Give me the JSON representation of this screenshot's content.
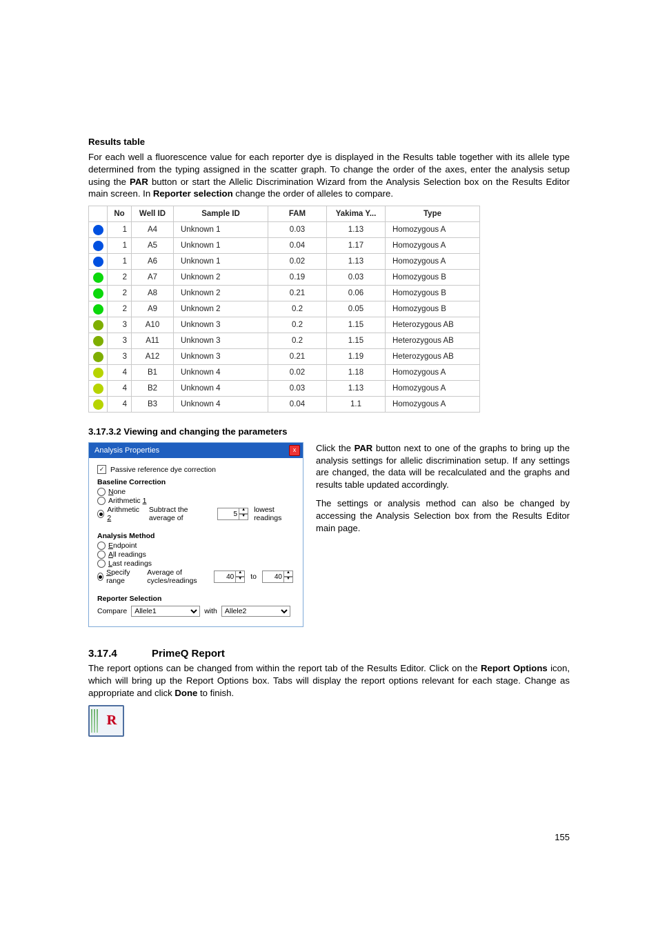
{
  "results_heading": "Results table",
  "results_para_a": "For each well a fluorescence value for each reporter dye is displayed in the Results table together with its allele type determined from the typing assigned in the scatter graph. To change the order of the axes, enter the analysis setup using the ",
  "results_para_b": "PAR",
  "results_para_c": " button or start the Allelic Discrimination Wizard from the Analysis Selection box on the Results Editor main screen. In ",
  "results_para_d": "Reporter selection",
  "results_para_e": " change the order of alleles to compare.",
  "tbl": {
    "headers": {
      "dot": "",
      "no": "No",
      "well": "Well ID",
      "sid": "Sample ID",
      "fam": "FAM",
      "yy": "Yakima Y...",
      "type": "Type"
    },
    "rows": [
      {
        "color": "blue",
        "no": "1",
        "well": "A4",
        "sid": "Unknown 1",
        "fam": "0.03",
        "yy": "1.13",
        "type": "Homozygous A"
      },
      {
        "color": "blue",
        "no": "1",
        "well": "A5",
        "sid": "Unknown 1",
        "fam": "0.04",
        "yy": "1.17",
        "type": "Homozygous A"
      },
      {
        "color": "blue",
        "no": "1",
        "well": "A6",
        "sid": "Unknown 1",
        "fam": "0.02",
        "yy": "1.13",
        "type": "Homozygous A"
      },
      {
        "color": "green",
        "no": "2",
        "well": "A7",
        "sid": "Unknown 2",
        "fam": "0.19",
        "yy": "0.03",
        "type": "Homozygous B"
      },
      {
        "color": "green",
        "no": "2",
        "well": "A8",
        "sid": "Unknown 2",
        "fam": "0.21",
        "yy": "0.06",
        "type": "Homozygous B"
      },
      {
        "color": "green",
        "no": "2",
        "well": "A9",
        "sid": "Unknown 2",
        "fam": "0.2",
        "yy": "0.05",
        "type": "Homozygous B"
      },
      {
        "color": "olive",
        "no": "3",
        "well": "A10",
        "sid": "Unknown 3",
        "fam": "0.2",
        "yy": "1.15",
        "type": "Heterozygous AB"
      },
      {
        "color": "olive",
        "no": "3",
        "well": "A11",
        "sid": "Unknown 3",
        "fam": "0.2",
        "yy": "1.15",
        "type": "Heterozygous AB"
      },
      {
        "color": "olive",
        "no": "3",
        "well": "A12",
        "sid": "Unknown 3",
        "fam": "0.21",
        "yy": "1.19",
        "type": "Heterozygous AB"
      },
      {
        "color": "ygreen",
        "no": "4",
        "well": "B1",
        "sid": "Unknown 4",
        "fam": "0.02",
        "yy": "1.18",
        "type": "Homozygous A"
      },
      {
        "color": "ygreen",
        "no": "4",
        "well": "B2",
        "sid": "Unknown 4",
        "fam": "0.03",
        "yy": "1.13",
        "type": "Homozygous A"
      },
      {
        "color": "ygreen",
        "no": "4",
        "well": "B3",
        "sid": "Unknown 4",
        "fam": "0.04",
        "yy": "1.1",
        "type": "Homozygous A"
      }
    ]
  },
  "sub_31732": "3.17.3.2   Viewing and changing the parameters",
  "panel": {
    "title": "Analysis Properties",
    "close": "x",
    "passive": "Passive reference dye correction",
    "bc_title": "Baseline Correction",
    "bc_none_pre": "",
    "bc_none_u": "N",
    "bc_none_post": "one",
    "bc_a1_pre": "Arithmetic ",
    "bc_a1_u": "1",
    "bc_a1_post": "",
    "bc_a2_pre": "Arithmetic ",
    "bc_a2_u": "2",
    "bc_a2_post": "",
    "bc_a2_tail_a": "Subtract the average of",
    "bc_a2_spin": "5",
    "bc_a2_tail_b": "lowest readings",
    "am_title": "Analysis Method",
    "am_end_u": "E",
    "am_end_post": "ndpoint",
    "am_all_u": "A",
    "am_all_post": "ll readings",
    "am_last_u": "L",
    "am_last_post": "ast readings",
    "am_spec_u": "S",
    "am_spec_post": "pecify range",
    "am_spec_mid": "Average of cycles/readings",
    "am_spec_from": "40",
    "am_spec_to_lbl": "to",
    "am_spec_to": "40",
    "rs_title": "Reporter Selection",
    "rs_compare": "Compare",
    "rs_sel1": "Allele1",
    "rs_with": "with",
    "rs_sel2": "Allele2"
  },
  "side_p1_a": "Click the ",
  "side_p1_b": "PAR",
  "side_p1_c": " button next to one of the graphs to bring up the analysis settings for allelic discrimination setup. If any settings are changed, the data will be recalculated and the graphs and results table updated accordingly.",
  "side_p2": "The settings or analysis method can also be changed by accessing the Analysis Selection box from the Results Editor main page.",
  "h3174_num": "3.17.4",
  "h3174_txt": "PrimeQ Report",
  "p3174_a": "The report options can be changed from within the report tab of the Results Editor. Click on the ",
  "p3174_b": "Report Options",
  "p3174_c": " icon, which will bring up the Report Options box. Tabs will display the report options relevant for each stage. Change as appropriate and click ",
  "p3174_d": "Done",
  "p3174_e": " to finish.",
  "ricon": "R",
  "page_number": "155"
}
